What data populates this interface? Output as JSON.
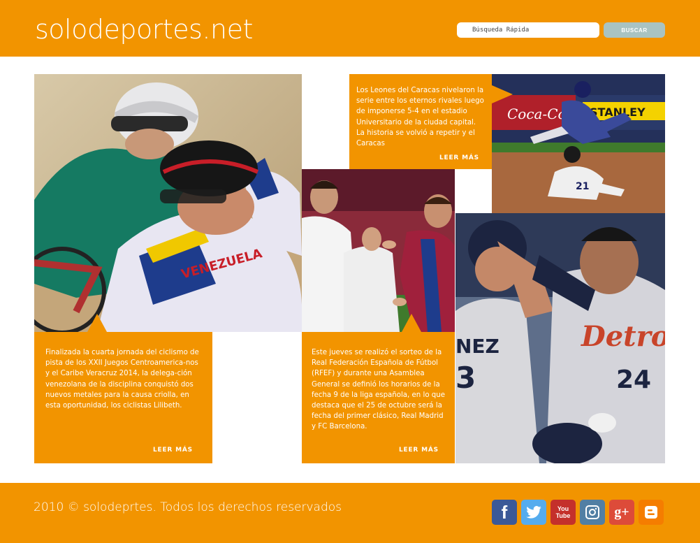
{
  "header": {
    "logo": "solodeportes.net",
    "search_placeholder": "Búsqueda Rápida",
    "search_button": "BUSCAR"
  },
  "articles": [
    {
      "text": "Finalizada la cuarta jornada del ciclismo de pista de los XXII Juegos Centroamerica-nos y el Caribe Veracruz 2014, la delega-ción venezolana de la disciplina conquistó dos nuevos metales para la causa criolla, en esta oportunidad, los ciclistas Lilibeth.",
      "more": "LEER MÁS"
    },
    {
      "text": "Este jueves se realizó el sorteo de la Real Federación Española de Fútbol (RFEF) y durante una Asamblea General se definió los horarios de la fecha 9 de la liga española, en lo que destaca que el 25 de octubre será la fecha del primer clásico, Real Madrid y FC Barcelona.",
      "more": "LEER MÁS"
    },
    {
      "text": "Los Leones del Caracas nivelaron la serie entre los eternos rivales luego de imponerse 5-4 en el estadio Universitario de la ciudad capital. La historia se volvió a repetir y el Caracas",
      "more": "LEER MÁS"
    }
  ],
  "photos": {
    "cycling_jersey_text": "VENEZUELA",
    "baseball_jersey_text": "Detroit",
    "baseball_number_right": "24",
    "baseball_number_left": "3",
    "baseball_name_left": "NEZ",
    "stadium_ad_1": "Coca-Cola",
    "stadium_ad_2": "STANLEY"
  },
  "footer": {
    "copyright": "2010 © solodeprtes. Todos los derechos reservados",
    "social": [
      {
        "name": "facebook",
        "color": "#3b5998",
        "glyph": "f"
      },
      {
        "name": "twitter",
        "color": "#55acee",
        "glyph": ""
      },
      {
        "name": "youtube",
        "color": "#c4302b",
        "glyph": "You Tube"
      },
      {
        "name": "instagram",
        "color": "#517fa4",
        "glyph": ""
      },
      {
        "name": "google-plus",
        "color": "#dd4b39",
        "glyph": "g+"
      },
      {
        "name": "blogger",
        "color": "#f57d00",
        "glyph": ""
      }
    ]
  },
  "colors": {
    "accent": "#f29400",
    "button": "#a9c3c2"
  }
}
